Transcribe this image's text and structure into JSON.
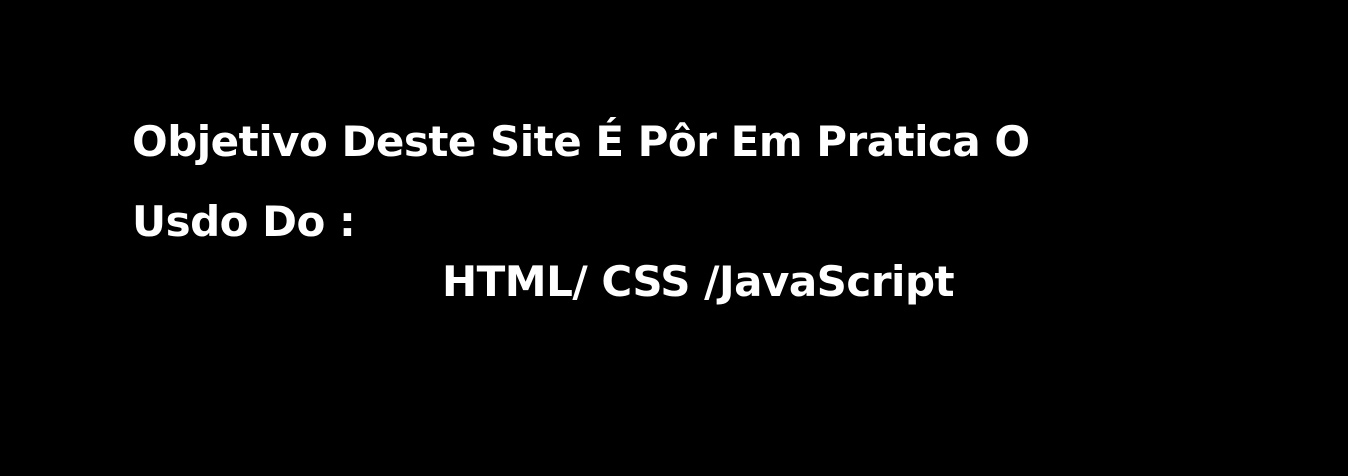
{
  "banner": {
    "line1": "Objetivo Deste Site É Pôr Em Pratica O",
    "line2": "Usdo Do :",
    "line3": "HTML/ CSS /JavaScript"
  },
  "colors": {
    "background": "#000000",
    "text": "#ffffff"
  }
}
